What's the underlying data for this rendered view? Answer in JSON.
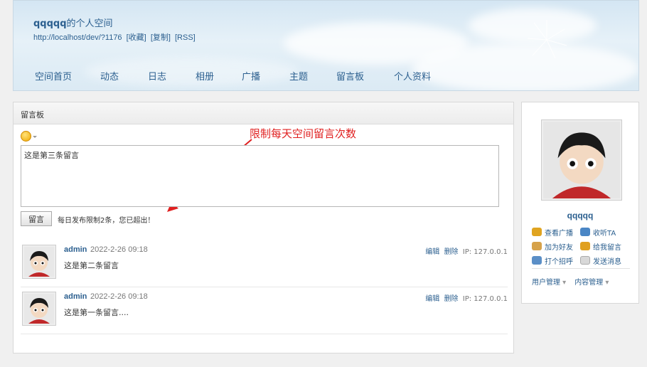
{
  "header": {
    "space_owner": "qqqqq",
    "space_title_suffix": "的个人空间",
    "url": "http://localhost/dev/?1176",
    "bookmark_link": "[收藏]",
    "copy_link": "[复制]",
    "rss_link": "[RSS]",
    "nav": [
      {
        "label": "空间首页"
      },
      {
        "label": "动态"
      },
      {
        "label": "日志"
      },
      {
        "label": "相册"
      },
      {
        "label": "广播"
      },
      {
        "label": "主题"
      },
      {
        "label": "留言板"
      },
      {
        "label": "个人资料"
      }
    ]
  },
  "board": {
    "title": "留言板",
    "input_value": "这是第三条留言",
    "submit_label": "留言",
    "limit_note": "每日发布限制2条，您已超出！",
    "annotation": "限制每天空间留言次数",
    "entries": [
      {
        "author": "admin",
        "time": "2022-2-26 09:18",
        "text": "这是第二条留言",
        "edit": "编辑",
        "delete": "删除",
        "ip": "IP: 127.0.0.1"
      },
      {
        "author": "admin",
        "time": "2022-2-26 09:18",
        "text": "这是第一条留言....",
        "edit": "编辑",
        "delete": "删除",
        "ip": "IP: 127.0.0.1"
      }
    ]
  },
  "sidebar": {
    "username": "qqqqq",
    "actions": [
      {
        "label": "查看广播",
        "icon": "megaphone-icon"
      },
      {
        "label": "收听TA",
        "icon": "follow-icon"
      },
      {
        "label": "加为好友",
        "icon": "handshake-icon"
      },
      {
        "label": "给我留言",
        "icon": "pencil-icon"
      },
      {
        "label": "打个招呼",
        "icon": "wave-icon"
      },
      {
        "label": "发送消息",
        "icon": "envelope-icon"
      }
    ],
    "menus": [
      {
        "label": "用户管理"
      },
      {
        "label": "内容管理"
      }
    ]
  },
  "colors": {
    "link": "#2b5f8f",
    "annotation": "#e02020"
  }
}
